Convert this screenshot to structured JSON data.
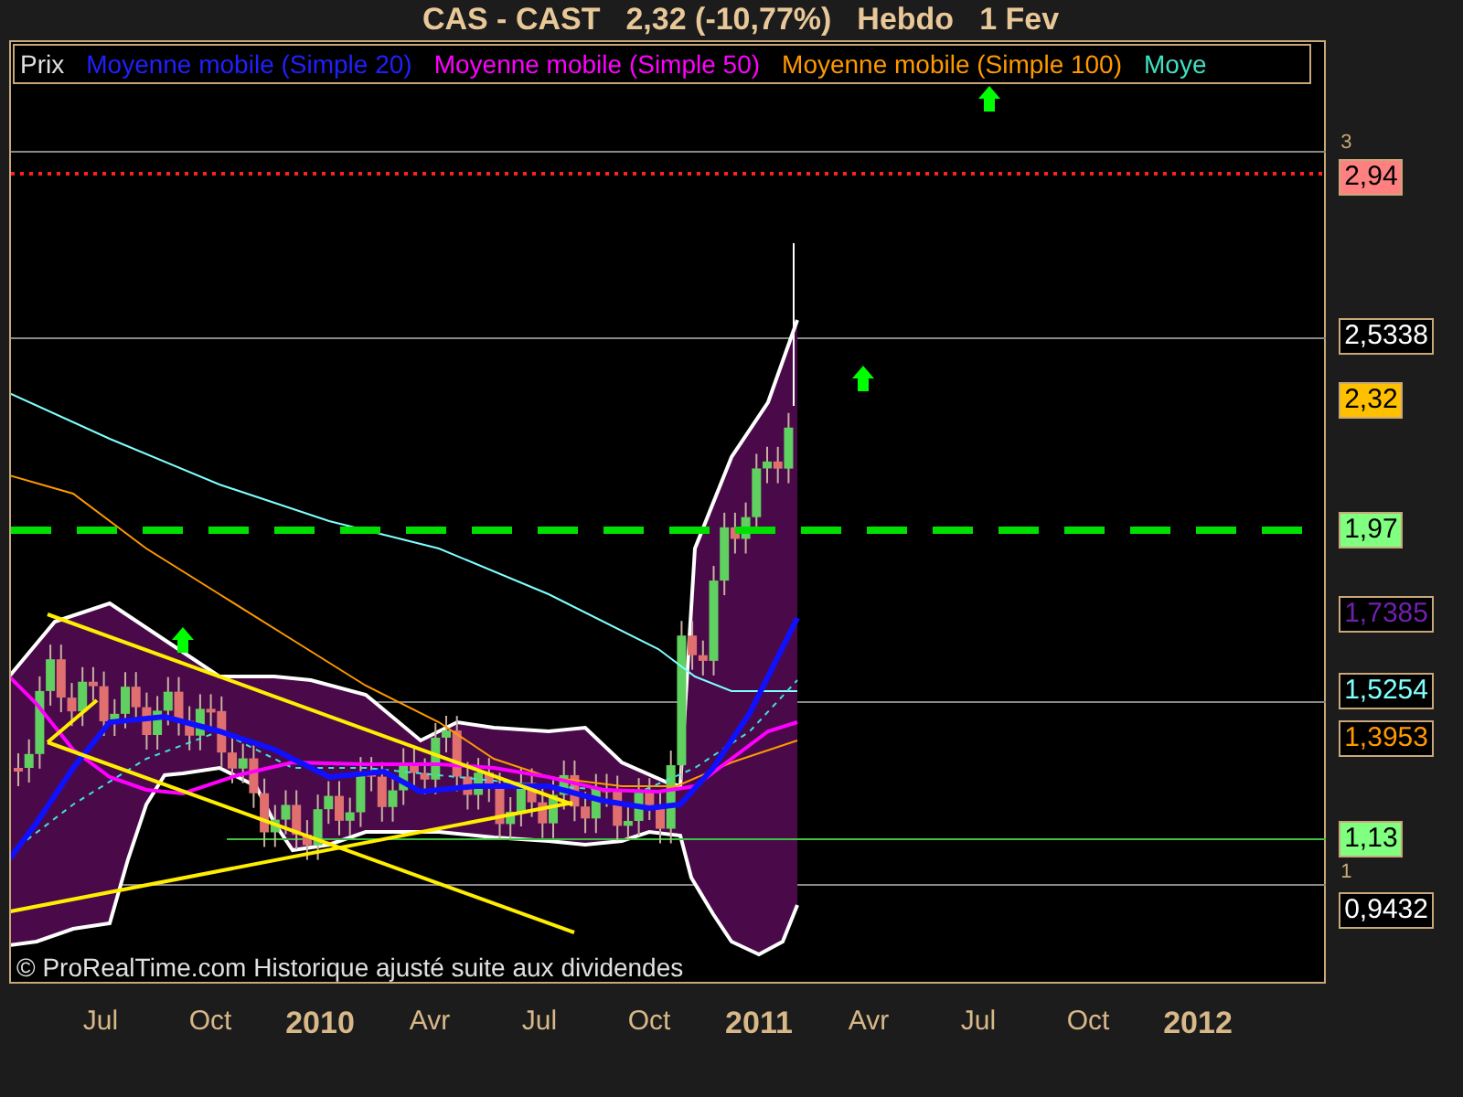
{
  "title": {
    "symbol": "CAS - CAST",
    "quote": "2,32 (-10,77%)",
    "period": "Hebdo",
    "date": "1 Fev"
  },
  "legend": [
    {
      "label": "Prix",
      "color": "#e0e0e0"
    },
    {
      "label": "Moyenne mobile (Simple 20)",
      "color": "#2020ff"
    },
    {
      "label": "Moyenne mobile (Simple 50)",
      "color": "#ff00ff"
    },
    {
      "label": "Moyenne mobile (Simple 100)",
      "color": "#ff9900"
    },
    {
      "label": "Moye",
      "color": "#40e0c0"
    }
  ],
  "price_axis": {
    "ticks": [
      "3",
      "1"
    ],
    "tags": [
      {
        "value": "2,94",
        "kind": "filled",
        "color": "#ff8080"
      },
      {
        "value": "2,5338",
        "kind": "outlined",
        "color": "#ffffff"
      },
      {
        "value": "2,32",
        "kind": "filled",
        "color": "#ffc000"
      },
      {
        "value": "1,97",
        "kind": "filled",
        "color": "#80ff80"
      },
      {
        "value": "1,7385",
        "kind": "outlined",
        "color": "#7020b0"
      },
      {
        "value": "1,5254",
        "kind": "outlined",
        "color": "#80ffff"
      },
      {
        "value": "1,3953",
        "kind": "outlined",
        "color": "#ff9900"
      },
      {
        "value": "1,13",
        "kind": "filled",
        "color": "#80ff80"
      },
      {
        "value": "0,9432",
        "kind": "outlined",
        "color": "#ffffff"
      }
    ]
  },
  "footer": "© ProRealTime.com Historique ajusté suite aux dividendes",
  "time_axis": [
    {
      "label": "Jul",
      "kind": "month"
    },
    {
      "label": "Oct",
      "kind": "month"
    },
    {
      "label": "2010",
      "kind": "year"
    },
    {
      "label": "Avr",
      "kind": "month"
    },
    {
      "label": "Jul",
      "kind": "month"
    },
    {
      "label": "Oct",
      "kind": "month"
    },
    {
      "label": "2011",
      "kind": "year"
    },
    {
      "label": "Avr",
      "kind": "month"
    },
    {
      "label": "Jul",
      "kind": "month"
    },
    {
      "label": "Oct",
      "kind": "month"
    },
    {
      "label": "2012",
      "kind": "year"
    }
  ]
}
